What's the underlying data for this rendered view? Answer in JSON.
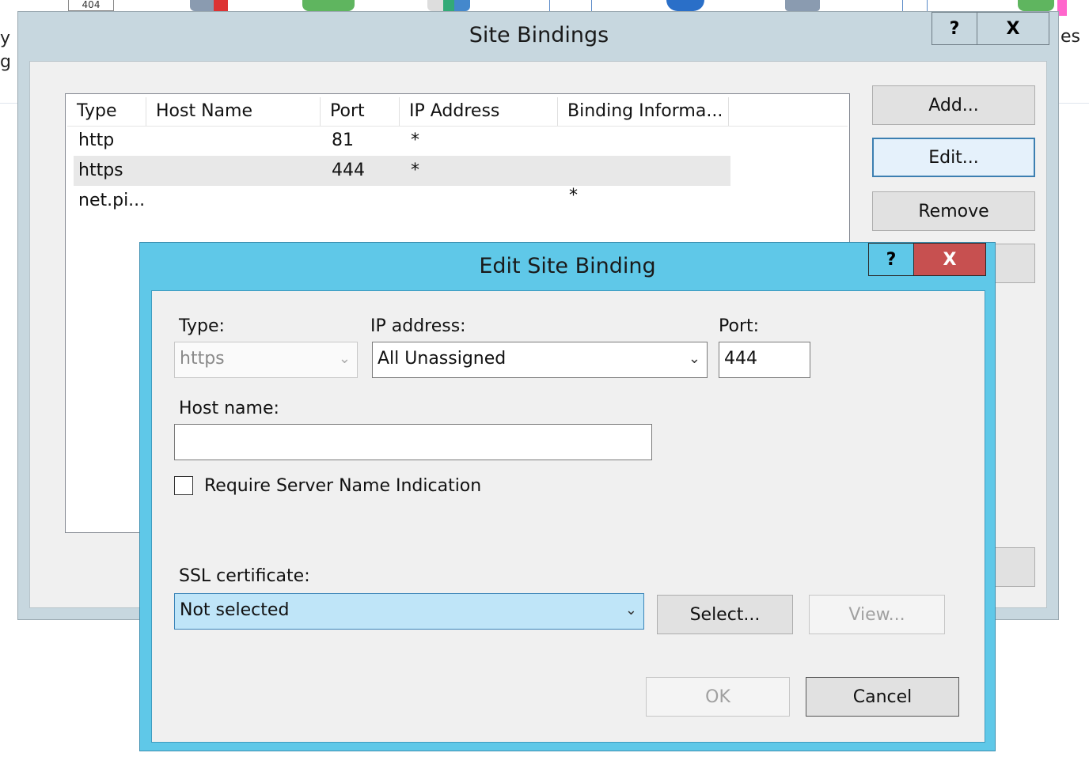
{
  "background": {
    "badge_404": "404",
    "left_text_1": "y",
    "left_text_2": "g",
    "right_text": "es"
  },
  "site_bindings": {
    "title": "Site Bindings",
    "help_label": "?",
    "close_label": "X",
    "columns": [
      "Type",
      "Host Name",
      "Port",
      "IP Address",
      "Binding Informa..."
    ],
    "rows": [
      {
        "type": "http",
        "host": "",
        "port": "81",
        "ip": "*",
        "info": ""
      },
      {
        "type": "https",
        "host": "",
        "port": "444",
        "ip": "*",
        "info": ""
      },
      {
        "type": "net.pi...",
        "host": "",
        "port": "",
        "ip": "",
        "info": "*"
      }
    ],
    "buttons": {
      "add": "Add...",
      "edit": "Edit...",
      "remove": "Remove"
    }
  },
  "edit_binding": {
    "title": "Edit Site Binding",
    "help_label": "?",
    "close_label": "X",
    "type_label": "Type:",
    "type_value": "https",
    "ip_label": "IP address:",
    "ip_value": "All Unassigned",
    "port_label": "Port:",
    "port_value": "444",
    "host_label": "Host name:",
    "host_value": "",
    "sni_label": "Require Server Name Indication",
    "sni_checked": false,
    "ssl_label": "SSL certificate:",
    "ssl_value": "Not selected",
    "select_label": "Select...",
    "view_label": "View...",
    "ok_label": "OK",
    "cancel_label": "Cancel"
  },
  "colors": {
    "dialog_frame": "#5fc8e8",
    "close_button": "#c75050",
    "selection_highlight": "#bfe5f8"
  }
}
